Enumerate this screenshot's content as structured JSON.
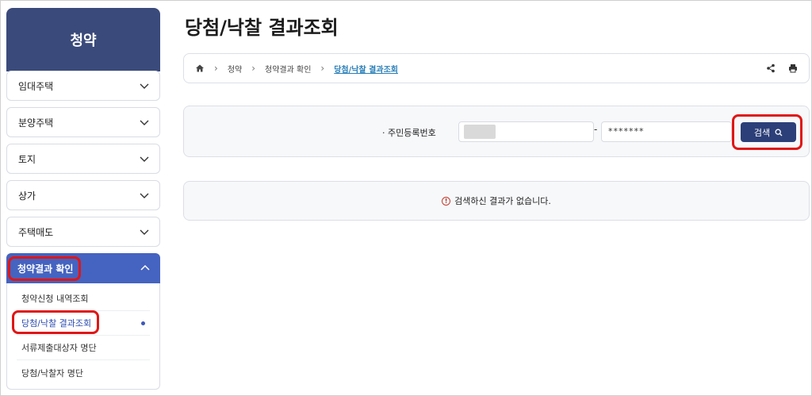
{
  "sidebar": {
    "title": "청약",
    "items": [
      {
        "label": "임대주택"
      },
      {
        "label": "분양주택"
      },
      {
        "label": "토지"
      },
      {
        "label": "상가"
      },
      {
        "label": "주택매도"
      }
    ],
    "active": {
      "label": "청약결과 확인",
      "subitems": [
        {
          "label": "청약신청 내역조회"
        },
        {
          "label": "당첨/낙찰 결과조회"
        },
        {
          "label": "서류제출대상자 명단"
        },
        {
          "label": "당첨/낙찰자 명단"
        }
      ]
    }
  },
  "page": {
    "title": "당첨/낙찰 결과조회"
  },
  "breadcrumb": {
    "home_icon": "home-icon",
    "items": [
      "청약",
      "청약결과 확인",
      "당첨/낙찰 결과조회"
    ],
    "share_icon": "share-icon",
    "print_icon": "print-icon"
  },
  "search": {
    "label": "· 주민등록번호",
    "separator": "-",
    "field2_value": "*******",
    "button_label": "검색"
  },
  "result": {
    "message": "검색하신 결과가 없습니다."
  },
  "colors": {
    "header": "#3a4a7b",
    "active": "#4563c0",
    "button": "#2c3f78",
    "highlight": "#e01616"
  }
}
